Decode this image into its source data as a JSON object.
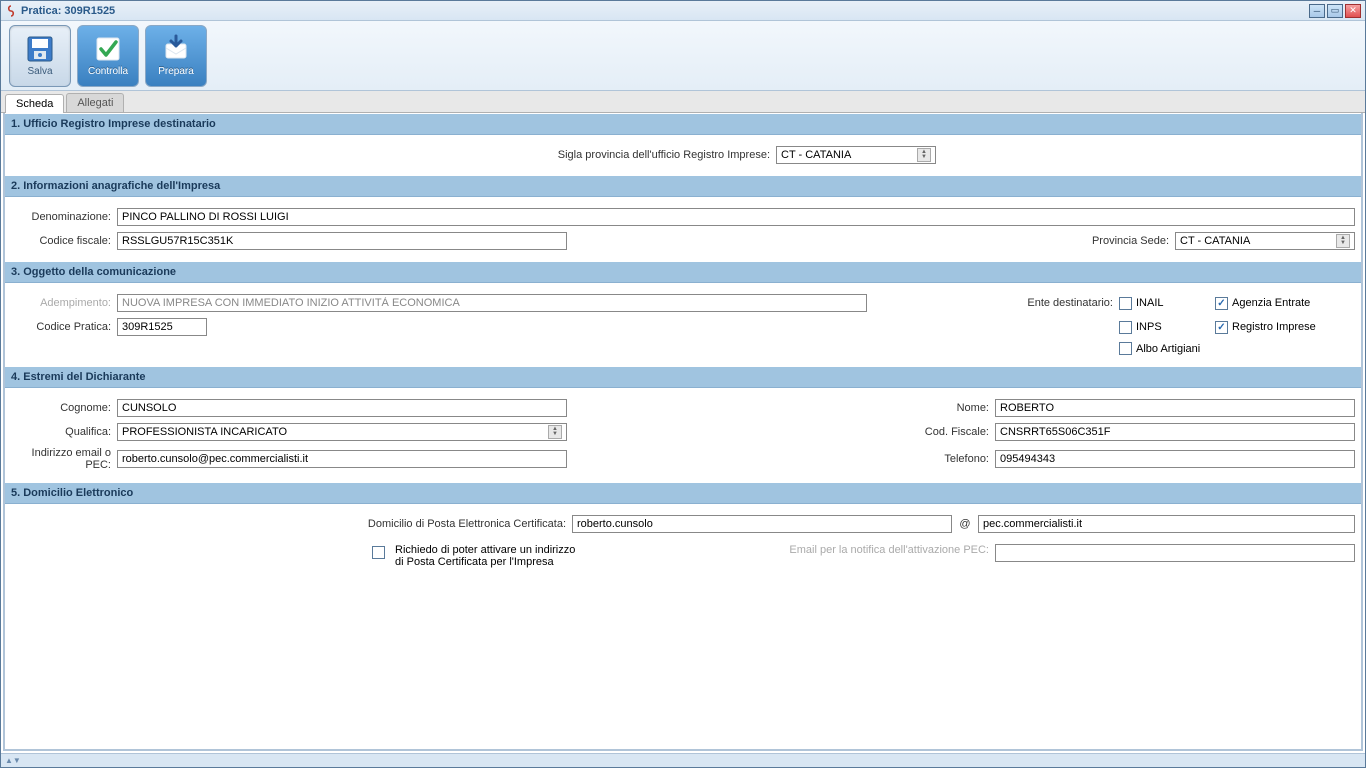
{
  "window": {
    "title": "Pratica: 309R1525"
  },
  "toolbar": {
    "salva": "Salva",
    "controlla": "Controlla",
    "prepara": "Prepara"
  },
  "tabs": {
    "scheda": "Scheda",
    "allegati": "Allegati"
  },
  "sections": {
    "s1": {
      "title": "1. Ufficio Registro Imprese destinatario",
      "sigla_label": "Sigla provincia dell'ufficio Registro Imprese:",
      "sigla_value": "CT - CATANIA"
    },
    "s2": {
      "title": "2. Informazioni anagrafiche dell'Impresa",
      "denominazione_label": "Denominazione:",
      "denominazione_value": "PINCO PALLINO DI ROSSI LUIGI",
      "cf_label": "Codice fiscale:",
      "cf_value": "RSSLGU57R15C351K",
      "provsede_label": "Provincia Sede:",
      "provsede_value": "CT - CATANIA"
    },
    "s3": {
      "title": "3. Oggetto della comunicazione",
      "adempimento_label": "Adempimento:",
      "adempimento_value": "NUOVA IMPRESA CON IMMEDIATO INIZIO ATTIVITÀ ECONOMICA",
      "codice_label": "Codice Pratica:",
      "codice_value": "309R1525",
      "ente_label": "Ente destinatario:",
      "inail": "INAIL",
      "inps": "INPS",
      "albo": "Albo Artigiani",
      "agenzia": "Agenzia Entrate",
      "registro": "Registro Imprese"
    },
    "s4": {
      "title": "4. Estremi del Dichiarante",
      "cognome_label": "Cognome:",
      "cognome_value": "CUNSOLO",
      "nome_label": "Nome:",
      "nome_value": "ROBERTO",
      "qualifica_label": "Qualifica:",
      "qualifica_value": "PROFESSIONISTA INCARICATO",
      "codf_label": "Cod. Fiscale:",
      "codf_value": "CNSRRT65S06C351F",
      "pec_label": "Indirizzo email o PEC:",
      "pec_value": "roberto.cunsolo@pec.commercialisti.it",
      "tel_label": "Telefono:",
      "tel_value": "095494343"
    },
    "s5": {
      "title": "5. Domicilio Elettronico",
      "dom_label": "Domicilio di Posta Elettronica Certificata:",
      "dom_local": "roberto.cunsolo",
      "at": "@",
      "dom_domain": "pec.commercialisti.it",
      "richiedo": "Richiedo di poter attivare un indirizzo di Posta Certificata per l'Impresa",
      "notifica_label": "Email per la notifica dell'attivazione PEC:",
      "notifica_value": ""
    }
  }
}
